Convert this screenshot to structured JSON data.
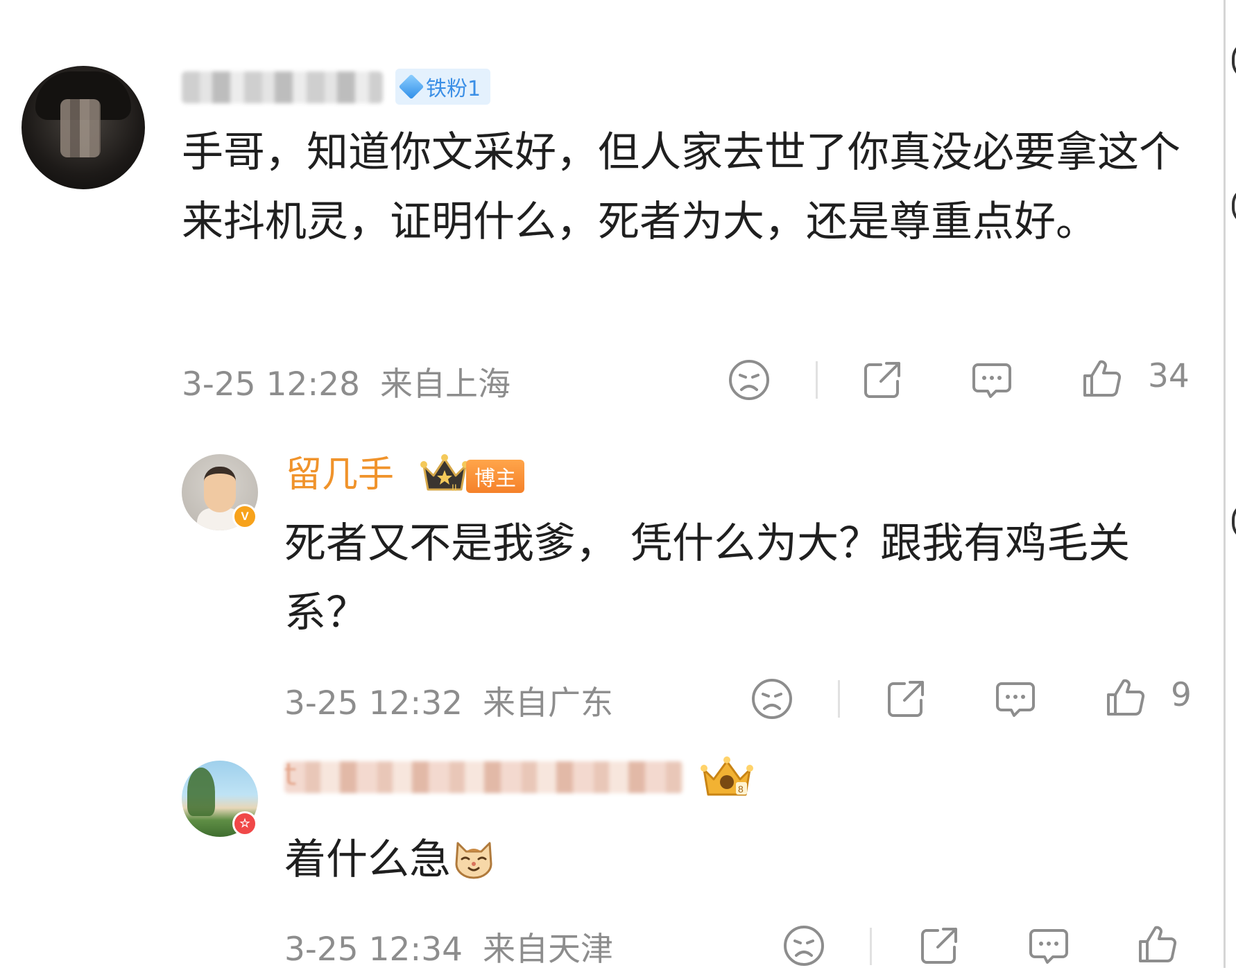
{
  "comments": [
    {
      "badge": "铁粉1",
      "text": "手哥，知道你文采好，但人家去世了你真没必要拿这个来抖机灵，证明什么，死者为大，还是尊重点好。",
      "time": "3-25 12:28",
      "location": "来自上海",
      "likes": "34"
    },
    {
      "author": "留几手",
      "badge": "博主",
      "crown_mark": "II",
      "verified": "V",
      "text": "死者又不是我爹， 凭什么为大？跟我有鸡毛关系？",
      "time": "3-25 12:32",
      "location": "来自广东",
      "likes": "9"
    },
    {
      "name_first_char": "t",
      "crown_mark": "8",
      "verified": "☆",
      "text": "着什么急",
      "time": "3-25 12:34",
      "location": "来自天津"
    }
  ],
  "icons": {
    "dislike": "sad-face-icon",
    "share": "share-icon",
    "comment": "comment-icon",
    "like": "thumbs-up-icon",
    "emoji": "cat-emoji-icon"
  },
  "colors": {
    "author": "#f0932b",
    "meta": "#8d8d8d",
    "fan_badge": "#3b8fe6"
  }
}
